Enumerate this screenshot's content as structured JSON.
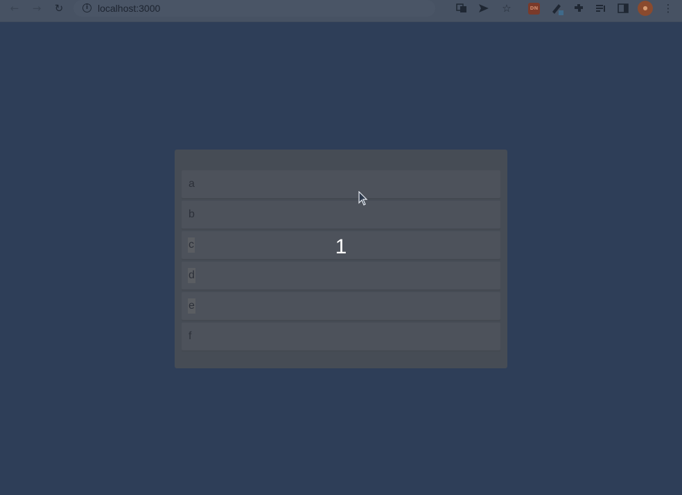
{
  "browser": {
    "url": "localhost:3000",
    "icons": [
      "back-icon",
      "forward-icon",
      "reload-icon",
      "info-icon",
      "translate-icon",
      "send-icon",
      "star-icon",
      "extension-icon",
      "pen-icon",
      "puzzle-icon",
      "reading-list-icon",
      "side-panel-icon",
      "avatar",
      "menu-icon"
    ]
  },
  "list": {
    "items": [
      {
        "label": "a"
      },
      {
        "label": "b"
      },
      {
        "label": "c"
      },
      {
        "label": "d"
      },
      {
        "label": "e"
      },
      {
        "label": "f"
      }
    ]
  },
  "counter": "1",
  "colors": {
    "page_background": "#2e3e58",
    "card_background": "#464c55",
    "item_background": "#4d525b",
    "counter_text": "#ffffff"
  }
}
